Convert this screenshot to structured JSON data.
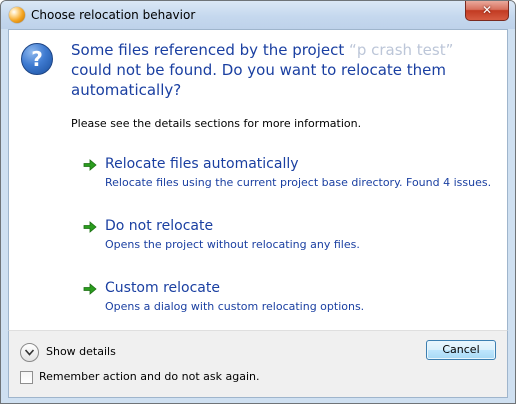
{
  "window": {
    "title": "Choose relocation behavior",
    "close_symbol": "✕"
  },
  "message": {
    "headline_prefix": "Some files referenced by the project",
    "project_name": "“p   crash  test”",
    "headline_suffix": "could not be found. Do you want to relocate them automatically?",
    "note": "Please see the details sections for more information.",
    "icon": "question-icon"
  },
  "options": [
    {
      "title": "Relocate files automatically",
      "description": "Relocate files using the current project base directory. Found 4 issues.",
      "icon": "green-arrow-icon"
    },
    {
      "title": "Do not relocate",
      "description": "Opens the project without relocating any files.",
      "icon": "green-arrow-icon"
    },
    {
      "title": "Custom relocate",
      "description": "Opens a dialog with custom relocating options.",
      "icon": "green-arrow-icon"
    }
  ],
  "footer": {
    "show_details_label": "Show details",
    "cancel_label": "Cancel",
    "remember_label": "Remember action and do not ask again.",
    "remember_checked": false
  },
  "colors": {
    "link_blue": "#1a3fa1",
    "arrow_green": "#2a9d1e",
    "chrome_blue": "#cfe0f1"
  }
}
